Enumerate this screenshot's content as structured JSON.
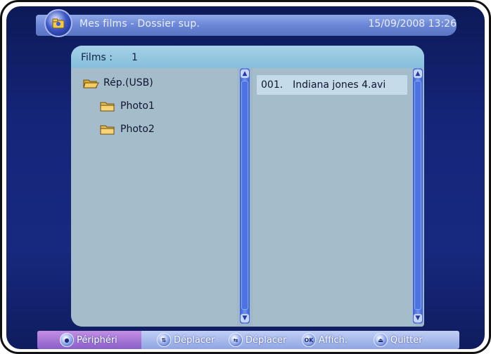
{
  "header": {
    "title": "Mes films - Dossier sup.",
    "datetime": "15/09/2008 13:26",
    "logo_icon": "film-folder-icon"
  },
  "panel": {
    "films_label": "Films :",
    "films_count": "1",
    "tree": [
      {
        "label": "Rép.(USB)",
        "icon": "open-folder-icon"
      },
      {
        "label": "Photo1",
        "icon": "folder-icon"
      },
      {
        "label": "Photo2",
        "icon": "folder-icon"
      }
    ],
    "files": [
      {
        "index": "001.",
        "name": "Indiana jones 4.avi"
      }
    ]
  },
  "footer": {
    "items": [
      {
        "label": "Périphéri",
        "icon": "globe-icon"
      },
      {
        "label": "Déplacer",
        "icon": "up-down-icon"
      },
      {
        "label": "Déplacer",
        "icon": "left-right-icon"
      },
      {
        "label": "Affich.",
        "icon": "ok-icon",
        "badge": "OK"
      },
      {
        "label": "Quitter",
        "icon": "exit-icon"
      }
    ]
  },
  "colors": {
    "background": "#15257a",
    "panel": "#a5bccb",
    "panel_header": "#86bedb",
    "selected_row": "#c5dbe9",
    "scrollbar": "#4d73e0",
    "footer": "#9fb2e8",
    "periph_tab": "#a574d6"
  }
}
